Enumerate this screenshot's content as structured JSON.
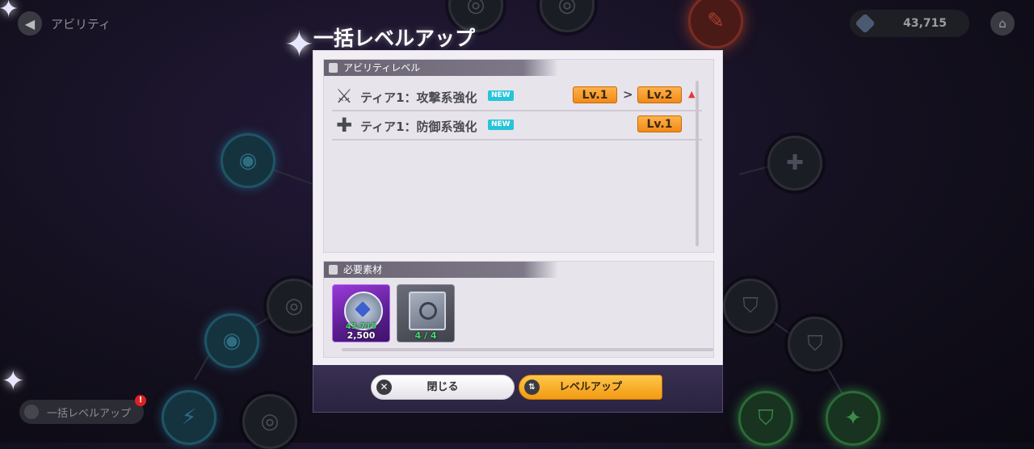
{
  "topbar": {
    "back_icon": "chevron-left-icon",
    "title": "アビリティ",
    "currency_amount": "43,715",
    "home_icon": "home-icon"
  },
  "bulk_levelup_bg_button": {
    "label": "一括レベルアップ",
    "badge": "!"
  },
  "modal": {
    "title": "一括レベルアップ",
    "ability_section": {
      "heading": "アビリティレベル",
      "rows": [
        {
          "icon": "sword-wings-icon",
          "name": "ティア1：攻撃系強化",
          "badge": "NEW",
          "from_level": "Lv.1",
          "arrow": ">",
          "to_level": "Lv.2",
          "indicator": "▲"
        },
        {
          "icon": "plus-icon",
          "name": "ティア1：防御系強化",
          "badge": "NEW",
          "level": "Lv.1"
        }
      ]
    },
    "materials_section": {
      "heading": "必要素材",
      "items": [
        {
          "icon": "gem-emblem-icon",
          "rarity": "purple",
          "have": "43,715",
          "need": "2,500"
        },
        {
          "icon": "book-icon",
          "rarity": "gray",
          "have": "",
          "count": "4 / 4"
        }
      ]
    },
    "buttons": {
      "close_label": "閉じる",
      "levelup_label": "レベルアップ"
    }
  },
  "colors": {
    "accent_orange": "#f29a12",
    "new_badge": "#26c4d8",
    "have_green": "#3fdc6a",
    "up_red": "#e23a3a"
  }
}
